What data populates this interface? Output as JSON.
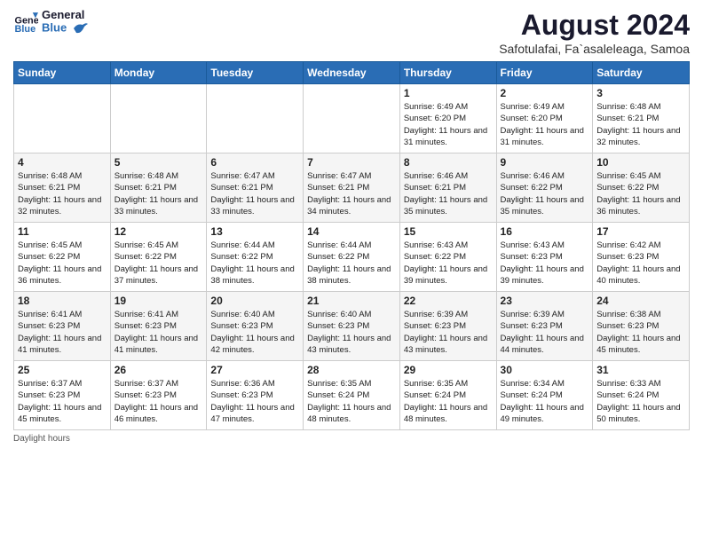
{
  "header": {
    "logo_general": "General",
    "logo_blue": "Blue",
    "month_title": "August 2024",
    "location": "Safotulafai, Fa`asaleleaga, Samoa"
  },
  "days_of_week": [
    "Sunday",
    "Monday",
    "Tuesday",
    "Wednesday",
    "Thursday",
    "Friday",
    "Saturday"
  ],
  "weeks": [
    [
      {
        "day": "",
        "info": ""
      },
      {
        "day": "",
        "info": ""
      },
      {
        "day": "",
        "info": ""
      },
      {
        "day": "",
        "info": ""
      },
      {
        "day": "1",
        "info": "Sunrise: 6:49 AM\nSunset: 6:20 PM\nDaylight: 11 hours and 31 minutes."
      },
      {
        "day": "2",
        "info": "Sunrise: 6:49 AM\nSunset: 6:20 PM\nDaylight: 11 hours and 31 minutes."
      },
      {
        "day": "3",
        "info": "Sunrise: 6:48 AM\nSunset: 6:21 PM\nDaylight: 11 hours and 32 minutes."
      }
    ],
    [
      {
        "day": "4",
        "info": "Sunrise: 6:48 AM\nSunset: 6:21 PM\nDaylight: 11 hours and 32 minutes."
      },
      {
        "day": "5",
        "info": "Sunrise: 6:48 AM\nSunset: 6:21 PM\nDaylight: 11 hours and 33 minutes."
      },
      {
        "day": "6",
        "info": "Sunrise: 6:47 AM\nSunset: 6:21 PM\nDaylight: 11 hours and 33 minutes."
      },
      {
        "day": "7",
        "info": "Sunrise: 6:47 AM\nSunset: 6:21 PM\nDaylight: 11 hours and 34 minutes."
      },
      {
        "day": "8",
        "info": "Sunrise: 6:46 AM\nSunset: 6:21 PM\nDaylight: 11 hours and 35 minutes."
      },
      {
        "day": "9",
        "info": "Sunrise: 6:46 AM\nSunset: 6:22 PM\nDaylight: 11 hours and 35 minutes."
      },
      {
        "day": "10",
        "info": "Sunrise: 6:45 AM\nSunset: 6:22 PM\nDaylight: 11 hours and 36 minutes."
      }
    ],
    [
      {
        "day": "11",
        "info": "Sunrise: 6:45 AM\nSunset: 6:22 PM\nDaylight: 11 hours and 36 minutes."
      },
      {
        "day": "12",
        "info": "Sunrise: 6:45 AM\nSunset: 6:22 PM\nDaylight: 11 hours and 37 minutes."
      },
      {
        "day": "13",
        "info": "Sunrise: 6:44 AM\nSunset: 6:22 PM\nDaylight: 11 hours and 38 minutes."
      },
      {
        "day": "14",
        "info": "Sunrise: 6:44 AM\nSunset: 6:22 PM\nDaylight: 11 hours and 38 minutes."
      },
      {
        "day": "15",
        "info": "Sunrise: 6:43 AM\nSunset: 6:22 PM\nDaylight: 11 hours and 39 minutes."
      },
      {
        "day": "16",
        "info": "Sunrise: 6:43 AM\nSunset: 6:23 PM\nDaylight: 11 hours and 39 minutes."
      },
      {
        "day": "17",
        "info": "Sunrise: 6:42 AM\nSunset: 6:23 PM\nDaylight: 11 hours and 40 minutes."
      }
    ],
    [
      {
        "day": "18",
        "info": "Sunrise: 6:41 AM\nSunset: 6:23 PM\nDaylight: 11 hours and 41 minutes."
      },
      {
        "day": "19",
        "info": "Sunrise: 6:41 AM\nSunset: 6:23 PM\nDaylight: 11 hours and 41 minutes."
      },
      {
        "day": "20",
        "info": "Sunrise: 6:40 AM\nSunset: 6:23 PM\nDaylight: 11 hours and 42 minutes."
      },
      {
        "day": "21",
        "info": "Sunrise: 6:40 AM\nSunset: 6:23 PM\nDaylight: 11 hours and 43 minutes."
      },
      {
        "day": "22",
        "info": "Sunrise: 6:39 AM\nSunset: 6:23 PM\nDaylight: 11 hours and 43 minutes."
      },
      {
        "day": "23",
        "info": "Sunrise: 6:39 AM\nSunset: 6:23 PM\nDaylight: 11 hours and 44 minutes."
      },
      {
        "day": "24",
        "info": "Sunrise: 6:38 AM\nSunset: 6:23 PM\nDaylight: 11 hours and 45 minutes."
      }
    ],
    [
      {
        "day": "25",
        "info": "Sunrise: 6:37 AM\nSunset: 6:23 PM\nDaylight: 11 hours and 45 minutes."
      },
      {
        "day": "26",
        "info": "Sunrise: 6:37 AM\nSunset: 6:23 PM\nDaylight: 11 hours and 46 minutes."
      },
      {
        "day": "27",
        "info": "Sunrise: 6:36 AM\nSunset: 6:23 PM\nDaylight: 11 hours and 47 minutes."
      },
      {
        "day": "28",
        "info": "Sunrise: 6:35 AM\nSunset: 6:24 PM\nDaylight: 11 hours and 48 minutes."
      },
      {
        "day": "29",
        "info": "Sunrise: 6:35 AM\nSunset: 6:24 PM\nDaylight: 11 hours and 48 minutes."
      },
      {
        "day": "30",
        "info": "Sunrise: 6:34 AM\nSunset: 6:24 PM\nDaylight: 11 hours and 49 minutes."
      },
      {
        "day": "31",
        "info": "Sunrise: 6:33 AM\nSunset: 6:24 PM\nDaylight: 11 hours and 50 minutes."
      }
    ]
  ],
  "footer": {
    "daylight_label": "Daylight hours"
  }
}
